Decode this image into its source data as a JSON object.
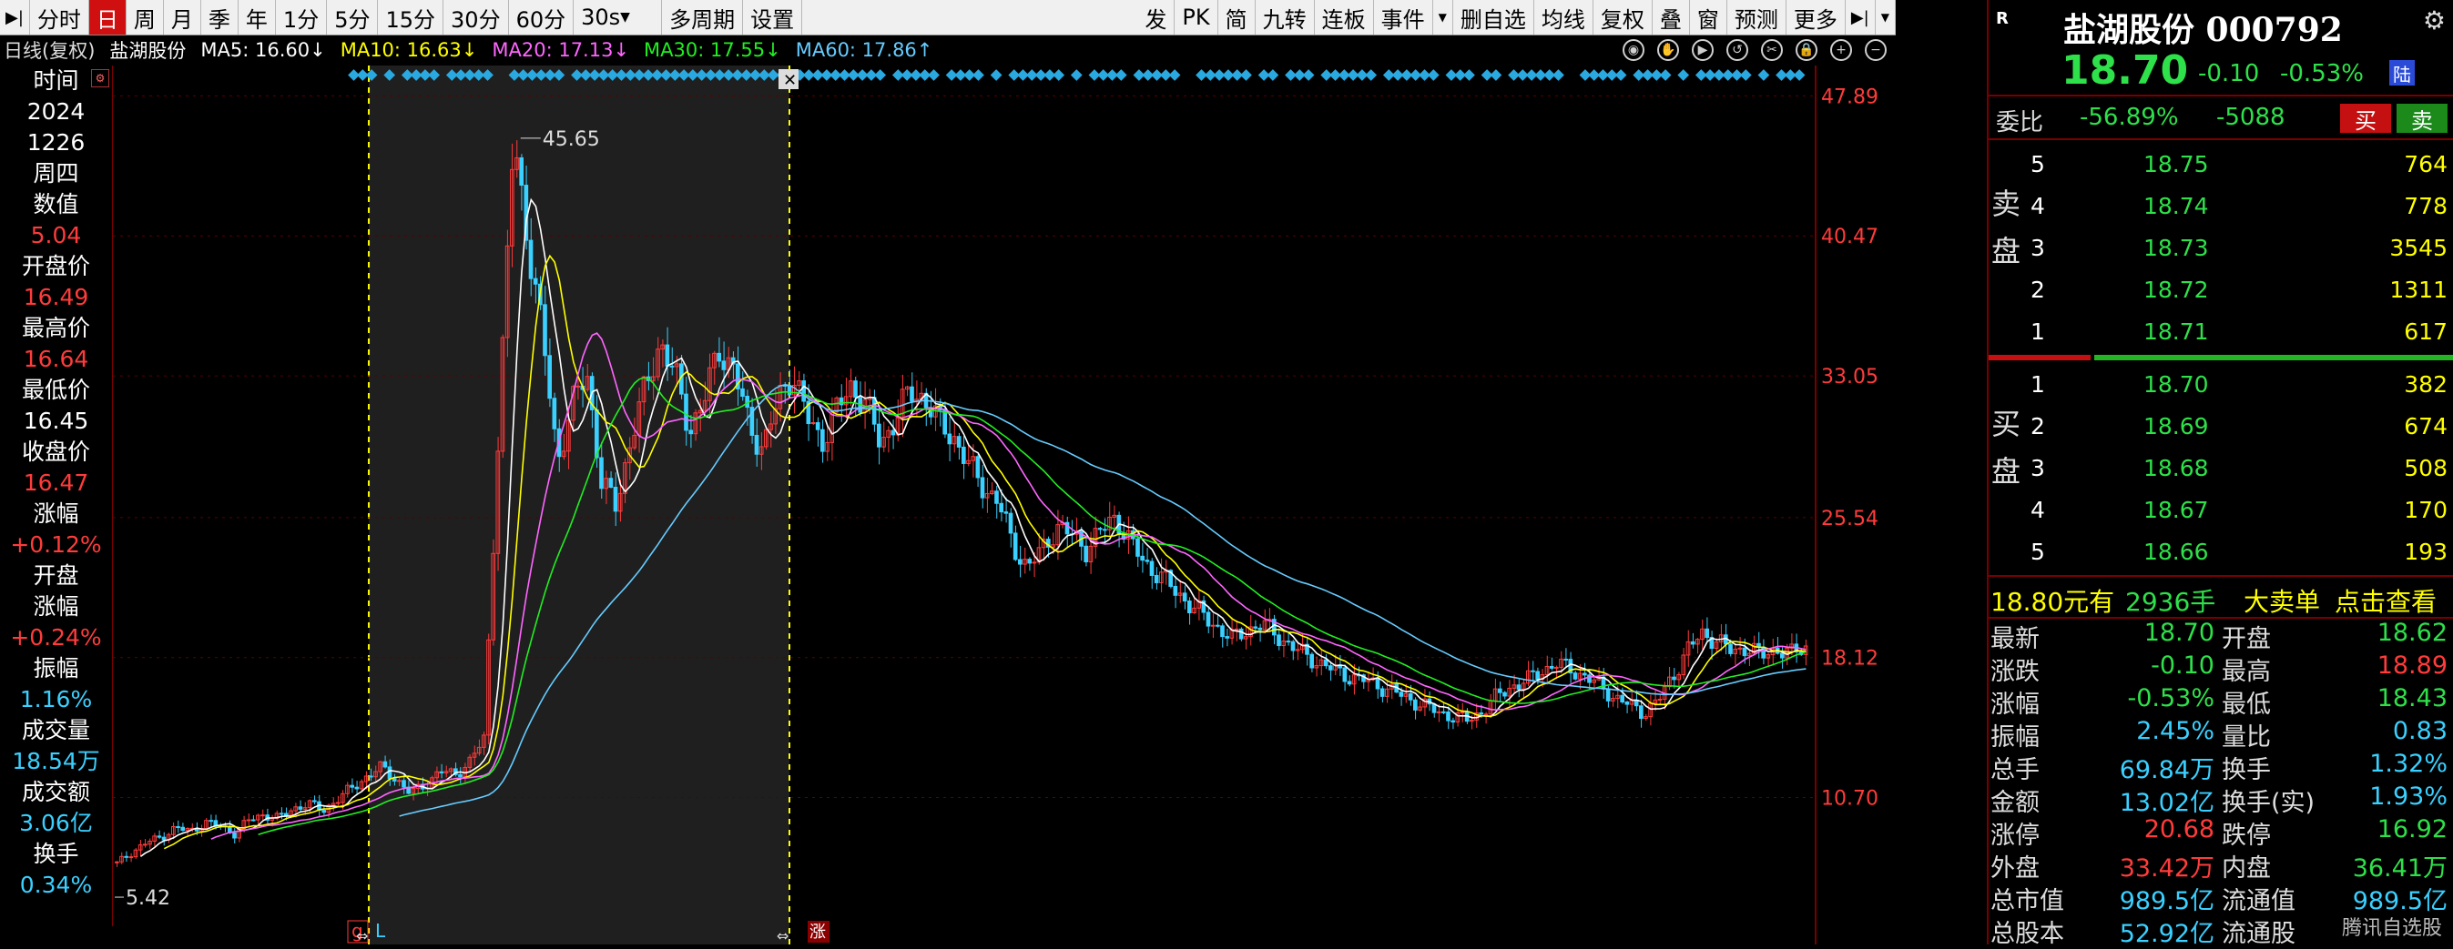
{
  "toolbar": {
    "left": [
      "分时",
      "日",
      "周",
      "月",
      "季",
      "年",
      "1分",
      "5分",
      "15分",
      "30分",
      "60分"
    ],
    "active": "日",
    "period_select": "30s",
    "more_left": [
      "多周期",
      "设置"
    ],
    "right": [
      "发",
      "PK",
      "简",
      "九转",
      "连板",
      "事件",
      "删自选",
      "均线",
      "复权",
      "叠",
      "窗",
      "预测",
      "更多"
    ]
  },
  "ma_bar": {
    "mode": "日线(复权)",
    "name": "盐湖股份",
    "items": [
      {
        "label": "MA5: 16.60↓",
        "color": "#ffffff"
      },
      {
        "label": "MA10: 16.63↓",
        "color": "#ffff00"
      },
      {
        "label": "MA20: 17.13↓",
        "color": "#ff66ff"
      },
      {
        "label": "MA30: 17.55↓",
        "color": "#22ee22"
      },
      {
        "label": "MA60: 17.86↑",
        "color": "#66ccff"
      }
    ]
  },
  "left_panel": [
    {
      "label": "时间",
      "value": "2024",
      "value2": "1226",
      "value3": "周四",
      "kind": "white"
    },
    {
      "label": "数值",
      "value": "5.04",
      "kind": "red"
    },
    {
      "label": "开盘价",
      "value": "16.49",
      "kind": "red"
    },
    {
      "label": "最高价",
      "value": "16.64",
      "kind": "red"
    },
    {
      "label": "最低价",
      "value": "16.45",
      "kind": "white"
    },
    {
      "label": "收盘价",
      "value": "16.47",
      "kind": "red"
    },
    {
      "label": "涨幅",
      "value": "+0.12%",
      "kind": "red"
    },
    {
      "label": "开盘\n涨幅",
      "value": "+0.24%",
      "kind": "red"
    },
    {
      "label": "振幅",
      "value": "1.16%",
      "kind": "cyan"
    },
    {
      "label": "成交量",
      "value": "18.54万",
      "kind": "cyan"
    },
    {
      "label": "成交额",
      "value": "3.06亿",
      "kind": "cyan"
    },
    {
      "label": "换手",
      "value": "0.34%",
      "kind": "cyan"
    }
  ],
  "chart_data": {
    "type": "candlestick",
    "y_ticks": [
      47.89,
      40.47,
      33.05,
      25.54,
      18.12,
      10.7
    ],
    "ylim": [
      3.3,
      49.5
    ],
    "peak_label": "45.65",
    "low_label": "5.42",
    "markers": [
      "g",
      "L",
      "涨"
    ],
    "highlight_range": [
      0.118,
      0.262
    ],
    "close_series": [
      7.2,
      7.8,
      8.3,
      8.6,
      9.1,
      8.9,
      9.4,
      9.2,
      8.8,
      9.5,
      9.8,
      9.6,
      10.1,
      10.4,
      10.0,
      10.6,
      11.2,
      11.8,
      12.3,
      11.7,
      10.9,
      11.4,
      12.1,
      11.9,
      12.6,
      13.8,
      30.5,
      45.6,
      40.2,
      35.1,
      28.6,
      31.5,
      33.2,
      27.4,
      26.1,
      29.8,
      32.4,
      34.9,
      33.1,
      30.2,
      31.8,
      34.5,
      33.4,
      30.5,
      29.2,
      31.7,
      33.3,
      30.8,
      29.6,
      31.2,
      32.5,
      31.6,
      29.4,
      30.8,
      32.2,
      31.9,
      30.5,
      29.8,
      28.3,
      27.2,
      26.4,
      24.1,
      22.9,
      23.8,
      25.1,
      24.6,
      23.9,
      24.8,
      25.6,
      24.2,
      23.1,
      22.5,
      21.7,
      21.0,
      20.3,
      19.7,
      19.1,
      19.6,
      19.9,
      19.3,
      18.7,
      18.2,
      17.8,
      17.4,
      17.1,
      16.9,
      16.6,
      16.3,
      15.9,
      15.6,
      15.2,
      15.0,
      14.8,
      15.3,
      16.1,
      16.6,
      16.9,
      17.4,
      17.8,
      17.5,
      17.1,
      16.6,
      16.0,
      15.6,
      15.2,
      15.9,
      17.2,
      18.6,
      19.4,
      19.0,
      18.4,
      18.7,
      18.2,
      18.6,
      18.3,
      18.7
    ],
    "ma_colors": [
      "#ffffff",
      "#ffff00",
      "#ff66ff",
      "#22ee22",
      "#66ccff"
    ]
  },
  "quote": {
    "badge": "R",
    "title": "盐湖股份 000792",
    "price": "18.70",
    "change": "-0.10",
    "pct": "-0.53%",
    "market_tag": "陆",
    "weibi_label": "委比",
    "weibi_pct": "-56.89%",
    "weibi_diff": "-5088",
    "buy_btn": "买",
    "sell_btn": "卖",
    "sell_label": "卖\n盘",
    "buy_label": "买\n盘",
    "asks": [
      {
        "lvl": "5",
        "price": "18.75",
        "vol": "764"
      },
      {
        "lvl": "4",
        "price": "18.74",
        "vol": "778"
      },
      {
        "lvl": "3",
        "price": "18.73",
        "vol": "3545"
      },
      {
        "lvl": "2",
        "price": "18.72",
        "vol": "1311"
      },
      {
        "lvl": "1",
        "price": "18.71",
        "vol": "617"
      }
    ],
    "bids": [
      {
        "lvl": "1",
        "price": "18.70",
        "vol": "382"
      },
      {
        "lvl": "2",
        "price": "18.69",
        "vol": "674"
      },
      {
        "lvl": "3",
        "price": "18.68",
        "vol": "508"
      },
      {
        "lvl": "4",
        "price": "18.67",
        "vol": "170"
      },
      {
        "lvl": "5",
        "price": "18.66",
        "vol": "193"
      }
    ],
    "big_order": {
      "price": "18.80元有",
      "qty": "2936手",
      "label": "大卖单",
      "action": "点击查看"
    },
    "stats": [
      {
        "l1": "最新",
        "v1": "18.70",
        "c1": "#2ee04a",
        "l2": "开盘",
        "v2": "18.62",
        "c2": "#2ee04a"
      },
      {
        "l1": "涨跌",
        "v1": "-0.10",
        "c1": "#2ee04a",
        "l2": "最高",
        "v2": "18.89",
        "c2": "#ff3b3b"
      },
      {
        "l1": "涨幅",
        "v1": "-0.53%",
        "c1": "#2ee04a",
        "l2": "最低",
        "v2": "18.43",
        "c2": "#2ee04a"
      },
      {
        "l1": "振幅",
        "v1": "2.45%",
        "c1": "#3ad0ff",
        "l2": "量比",
        "v2": "0.83",
        "c2": "#3ad0ff"
      },
      {
        "l1": "总手",
        "v1": "69.84万",
        "c1": "#3ad0ff",
        "l2": "换手",
        "v2": "1.32%",
        "c2": "#3ad0ff"
      },
      {
        "l1": "金额",
        "v1": "13.02亿",
        "c1": "#3ad0ff",
        "l2": "换手(实)",
        "v2": "1.93%",
        "c2": "#3ad0ff"
      },
      {
        "l1": "涨停",
        "v1": "20.68",
        "c1": "#ff3b3b",
        "l2": "跌停",
        "v2": "16.92",
        "c2": "#2ee04a"
      },
      {
        "l1": "外盘",
        "v1": "33.42万",
        "c1": "#ff3b3b",
        "l2": "内盘",
        "v2": "36.41万",
        "c2": "#2ee04a"
      },
      {
        "l1": "总市值",
        "v1": "989.5亿",
        "c1": "#3ad0ff",
        "l2": "流通值",
        "v2": "989.5亿",
        "c2": "#3ad0ff"
      },
      {
        "l1": "总股本",
        "v1": "52.92亿",
        "c1": "#3ad0ff",
        "l2": "流通股",
        "v2": "",
        "c2": "#3ad0ff"
      }
    ],
    "watermark": "腾讯自选股"
  }
}
